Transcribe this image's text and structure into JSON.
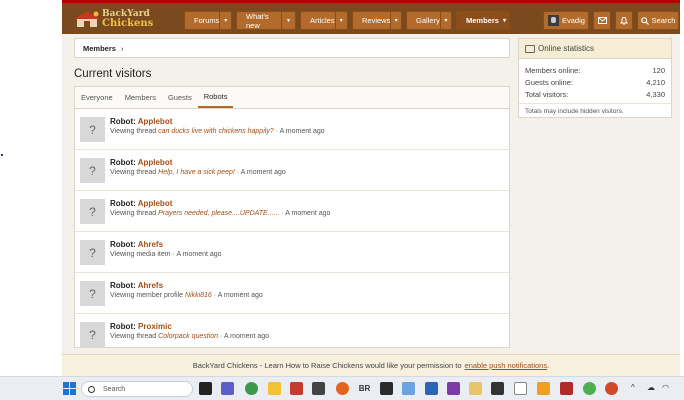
{
  "header": {
    "logo_line1": "BackYard",
    "logo_line2": "Chickens",
    "nav": [
      {
        "label": "Forums"
      },
      {
        "label": "What's new"
      },
      {
        "label": "Articles"
      },
      {
        "label": "Reviews"
      },
      {
        "label": "Gallery"
      },
      {
        "label": "Members"
      }
    ],
    "username": "Evadig",
    "search_label": "Search"
  },
  "breadcrumb": {
    "label": "Members"
  },
  "page_title": "Current visitors",
  "tabs": [
    {
      "label": "Everyone"
    },
    {
      "label": "Members"
    },
    {
      "label": "Guests"
    },
    {
      "label": "Robots"
    }
  ],
  "visitors": [
    {
      "prefix": "Robot:",
      "bot": "Applebot",
      "action": "Viewing thread",
      "target": "can ducks live with chickens happily?",
      "time": "A moment ago"
    },
    {
      "prefix": "Robot:",
      "bot": "Applebot",
      "action": "Viewing thread",
      "target": "Help, I have a sick peep!",
      "time": "A moment ago"
    },
    {
      "prefix": "Robot:",
      "bot": "Applebot",
      "action": "Viewing thread",
      "target": "Prayers needed, please....UPDATE......",
      "time": "A moment ago"
    },
    {
      "prefix": "Robot:",
      "bot": "Ahrefs",
      "action": "Viewing media item",
      "target": "",
      "time": "A moment ago"
    },
    {
      "prefix": "Robot:",
      "bot": "Ahrefs",
      "action": "Viewing member profile",
      "target": "Nikki816",
      "time": "A moment ago"
    },
    {
      "prefix": "Robot:",
      "bot": "Proximic",
      "action": "Viewing thread",
      "target": "Colorpack question",
      "time": "A moment ago"
    }
  ],
  "avatar_placeholder": "?",
  "separator": "·",
  "sidebar": {
    "title": "Online statistics",
    "stats": [
      {
        "label": "Members online:",
        "value": "120"
      },
      {
        "label": "Guests online:",
        "value": "4,210"
      },
      {
        "label": "Total visitors:",
        "value": "4,330"
      }
    ],
    "note": "Totals may include hidden visitors."
  },
  "push_notice": {
    "text": "BackYard Chickens - Learn How to Raise Chickens would like your permission to",
    "link": "enable push notifications",
    "end": "."
  },
  "taskbar": {
    "search_placeholder": "Search",
    "br_label": "BR"
  },
  "colors": {
    "header_bg": "#7a4a1f",
    "nav_tab": "#b36b2b",
    "link": "#a0501a",
    "accent_red": "#b30000"
  }
}
